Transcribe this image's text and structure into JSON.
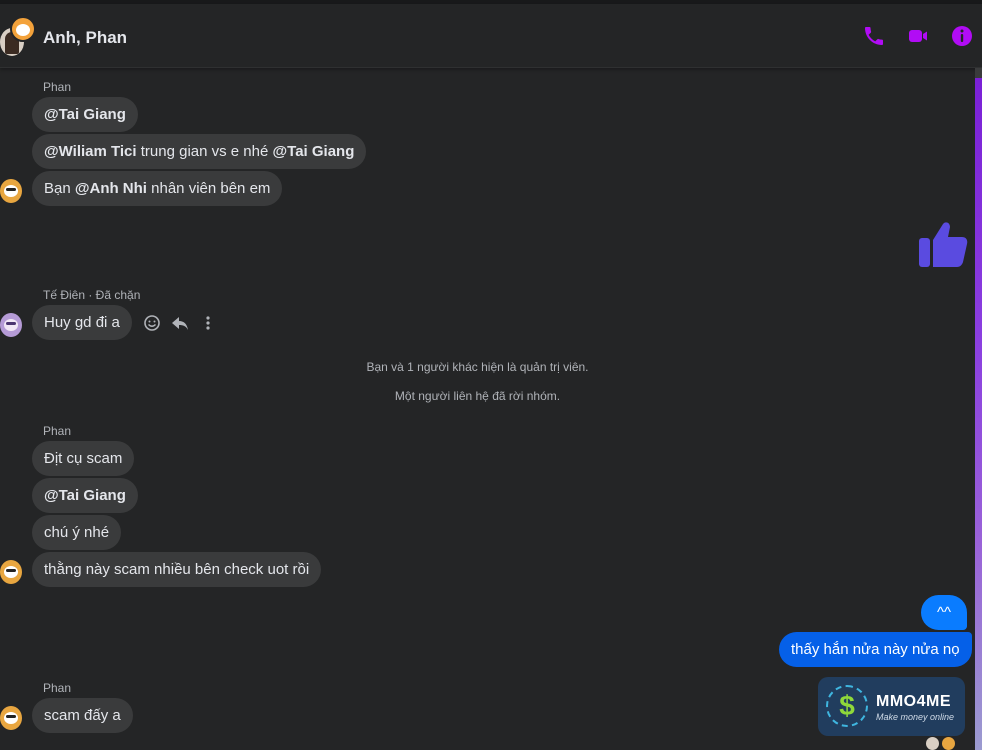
{
  "header": {
    "title": "Anh, Phan",
    "accent_color": "#b10cf5",
    "icons": [
      "phone-icon",
      "video-camera-icon",
      "info-icon"
    ]
  },
  "messages": [
    {
      "sender": "Phan",
      "parts": [
        {
          "text": "@Tai Giang",
          "bold": true
        }
      ]
    },
    {
      "parts": [
        {
          "text": "@Wiliam Tici",
          "bold": true
        },
        {
          "text": " trung gian vs e nhé ",
          "bold": false
        },
        {
          "text": "@Tai Giang",
          "bold": true
        }
      ]
    },
    {
      "parts": [
        {
          "text": "Bạn ",
          "bold": false
        },
        {
          "text": "@Anh Nhi",
          "bold": true
        },
        {
          "text": " nhân viên bên em",
          "bold": false
        }
      ]
    },
    {
      "sender": "Tế Điên · Đã chặn",
      "text": "Huy gd đi a"
    },
    {
      "sender": "Phan",
      "text": "Địt cụ scam"
    },
    {
      "parts": [
        {
          "text": "@Tai Giang",
          "bold": true
        }
      ]
    },
    {
      "text": "chú ý nhé"
    },
    {
      "text": "thằng này scam nhiều bên check uot rồi"
    },
    {
      "sender": "Phan",
      "text": "scam đấy a"
    }
  ],
  "system_notices": [
    "Bạn và 1 người khác hiện là quản trị viên.",
    "Một người liên hệ đã rời nhóm."
  ],
  "my_messages": [
    {
      "text": "^^",
      "color": "#0a7cff"
    },
    {
      "text": "thấy hắn nửa này nửa nọ",
      "color": "#0560e8"
    }
  ],
  "reaction_icons": [
    "emoji-icon",
    "reply-icon",
    "more-icon"
  ],
  "like_color": "#5a4be0",
  "watermark": {
    "name": "MMO4ME",
    "tagline": "Make money online",
    "symbol": "$"
  }
}
